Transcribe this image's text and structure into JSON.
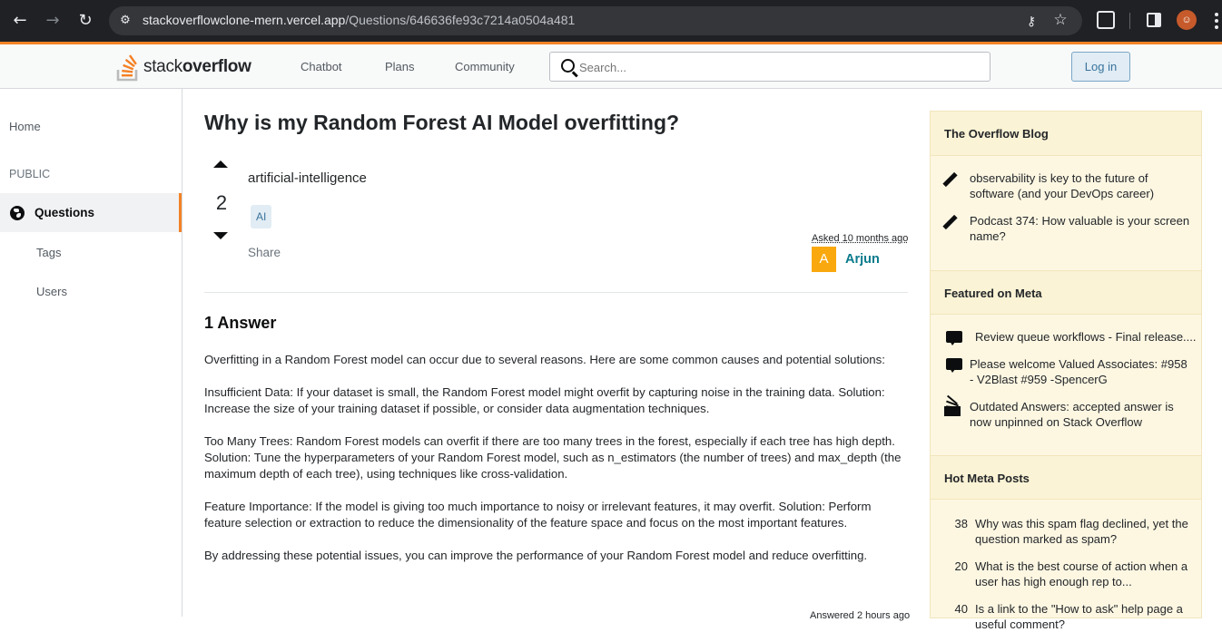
{
  "browser": {
    "url_host": "stackoverflowclone-mern.vercel.app",
    "url_path": "/Questions/646636fe93c7214a0504a481"
  },
  "header": {
    "logo_light": "stack",
    "logo_bold": "overflow",
    "nav": [
      "Chatbot",
      "Plans",
      "Community"
    ],
    "search_placeholder": "Search...",
    "login_label": "Log in"
  },
  "sidebar": {
    "home": "Home",
    "public": "PUBLIC",
    "questions": "Questions",
    "tags": "Tags",
    "users": "Users"
  },
  "question": {
    "title": "Why is my Random Forest AI Model overfitting?",
    "votes": "2",
    "body": "artificial-intelligence",
    "tag": "AI",
    "share": "Share",
    "asked": "Asked 10 months ago",
    "author_initial": "A",
    "author": "Arjun"
  },
  "answers": {
    "count_label": "1 Answer",
    "paragraphs": [
      "Overfitting in a Random Forest model can occur due to several reasons. Here are some common causes and potential solutions:",
      "Insufficient Data: If your dataset is small, the Random Forest model might overfit by capturing noise in the training data. Solution: Increase the size of your training dataset if possible, or consider data augmentation techniques.",
      "Too Many Trees: Random Forest models can overfit if there are too many trees in the forest, especially if each tree has high depth. Solution: Tune the hyperparameters of your Random Forest model, such as n_estimators (the number of trees) and max_depth (the maximum depth of each tree), using techniques like cross-validation.",
      "Feature Importance: If the model is giving too much importance to noisy or irrelevant features, it may overfit. Solution: Perform feature selection or extraction to reduce the dimensionality of the feature space and focus on the most important features.",
      "By addressing these potential issues, you can improve the performance of your Random Forest model and reduce overfitting."
    ],
    "answered": "Answered 2 hours ago"
  },
  "widgets": {
    "blog_title": "The Overflow Blog",
    "blog_items": [
      "observability is key to the future of software (and your DevOps career)",
      "Podcast 374: How valuable is your screen name?"
    ],
    "meta_title": "Featured on Meta",
    "meta_items": [
      "Review queue workflows - Final release....",
      "Please welcome Valued Associates: #958 - V2Blast #959 -SpencerG",
      "Outdated Answers: accepted answer is now unpinned on Stack Overflow"
    ],
    "hot_title": "Hot Meta Posts",
    "hot_items": [
      {
        "count": "38",
        "text": "Why was this spam flag declined, yet the question marked as spam?"
      },
      {
        "count": "20",
        "text": "What is the best course of action when a user has high enough rep to..."
      },
      {
        "count": "40",
        "text": "Is a link to the \"How to ask\" help page a useful comment?"
      }
    ]
  }
}
